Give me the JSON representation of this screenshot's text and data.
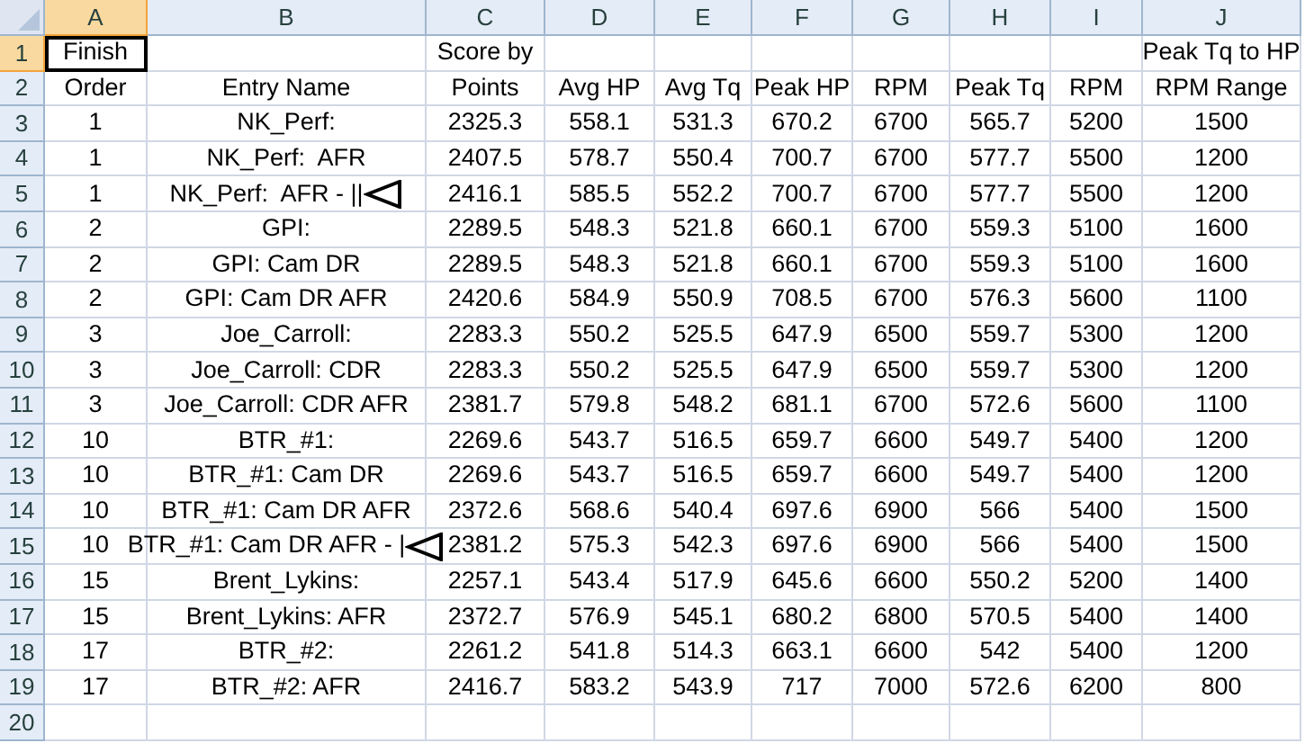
{
  "columns": [
    {
      "label": "A",
      "selected": true
    },
    {
      "label": "B",
      "selected": false
    },
    {
      "label": "C",
      "selected": false
    },
    {
      "label": "D",
      "selected": false
    },
    {
      "label": "E",
      "selected": false
    },
    {
      "label": "F",
      "selected": false
    },
    {
      "label": "G",
      "selected": false
    },
    {
      "label": "H",
      "selected": false
    },
    {
      "label": "I",
      "selected": false
    },
    {
      "label": "J",
      "selected": false
    }
  ],
  "rows": [
    {
      "number": "1",
      "selected": true,
      "arrow": false,
      "cells": [
        "Finish",
        null,
        "Score by",
        null,
        null,
        null,
        null,
        null,
        null,
        "Peak Tq to HP"
      ]
    },
    {
      "number": "2",
      "selected": false,
      "arrow": false,
      "cells": [
        "Order",
        "Entry Name",
        "Points",
        "Avg HP",
        "Avg Tq",
        "Peak HP",
        "RPM",
        "Peak Tq",
        "RPM",
        "RPM Range"
      ]
    },
    {
      "number": "3",
      "selected": false,
      "arrow": false,
      "cells": [
        "1",
        "NK_Perf:",
        "2325.3",
        "558.1",
        "531.3",
        "670.2",
        "6700",
        "565.7",
        "5200",
        "1500"
      ]
    },
    {
      "number": "4",
      "selected": false,
      "arrow": false,
      "cells": [
        "1",
        "NK_Perf:  AFR",
        "2407.5",
        "578.7",
        "550.4",
        "700.7",
        "6700",
        "577.7",
        "5500",
        "1200"
      ]
    },
    {
      "number": "5",
      "selected": false,
      "arrow": true,
      "cells": [
        "1",
        "NK_Perf:  AFR - ||",
        "2416.1",
        "585.5",
        "552.2",
        "700.7",
        "6700",
        "577.7",
        "5500",
        "1200"
      ]
    },
    {
      "number": "6",
      "selected": false,
      "arrow": false,
      "cells": [
        "2",
        "GPI:",
        "2289.5",
        "548.3",
        "521.8",
        "660.1",
        "6700",
        "559.3",
        "5100",
        "1600"
      ]
    },
    {
      "number": "7",
      "selected": false,
      "arrow": false,
      "cells": [
        "2",
        "GPI: Cam DR",
        "2289.5",
        "548.3",
        "521.8",
        "660.1",
        "6700",
        "559.3",
        "5100",
        "1600"
      ]
    },
    {
      "number": "8",
      "selected": false,
      "arrow": false,
      "cells": [
        "2",
        "GPI: Cam DR AFR",
        "2420.6",
        "584.9",
        "550.9",
        "708.5",
        "6700",
        "576.3",
        "5600",
        "1100"
      ]
    },
    {
      "number": "9",
      "selected": false,
      "arrow": false,
      "cells": [
        "3",
        "Joe_Carroll:",
        "2283.3",
        "550.2",
        "525.5",
        "647.9",
        "6500",
        "559.7",
        "5300",
        "1200"
      ]
    },
    {
      "number": "10",
      "selected": false,
      "arrow": false,
      "cells": [
        "3",
        "Joe_Carroll: CDR",
        "2283.3",
        "550.2",
        "525.5",
        "647.9",
        "6500",
        "559.7",
        "5300",
        "1200"
      ]
    },
    {
      "number": "11",
      "selected": false,
      "arrow": false,
      "cells": [
        "3",
        "Joe_Carroll: CDR AFR",
        "2381.7",
        "579.8",
        "548.2",
        "681.1",
        "6700",
        "572.6",
        "5600",
        "1100"
      ]
    },
    {
      "number": "12",
      "selected": false,
      "arrow": false,
      "cells": [
        "10",
        "BTR_#1:",
        "2269.6",
        "543.7",
        "516.5",
        "659.7",
        "6600",
        "549.7",
        "5400",
        "1200"
      ]
    },
    {
      "number": "13",
      "selected": false,
      "arrow": false,
      "cells": [
        "10",
        "BTR_#1: Cam DR",
        "2269.6",
        "543.7",
        "516.5",
        "659.7",
        "6600",
        "549.7",
        "5400",
        "1200"
      ]
    },
    {
      "number": "14",
      "selected": false,
      "arrow": false,
      "cells": [
        "10",
        "BTR_#1: Cam DR AFR",
        "2372.6",
        "568.6",
        "540.4",
        "697.6",
        "6900",
        "566",
        "5400",
        "1500"
      ]
    },
    {
      "number": "15",
      "selected": false,
      "arrow": true,
      "cells": [
        "10",
        "BTR_#1: Cam DR AFR - |",
        "2381.2",
        "575.3",
        "542.3",
        "697.6",
        "6900",
        "566",
        "5400",
        "1500"
      ]
    },
    {
      "number": "16",
      "selected": false,
      "arrow": false,
      "cells": [
        "15",
        "Brent_Lykins:",
        "2257.1",
        "543.4",
        "517.9",
        "645.6",
        "6600",
        "550.2",
        "5200",
        "1400"
      ]
    },
    {
      "number": "17",
      "selected": false,
      "arrow": false,
      "cells": [
        "15",
        "Brent_Lykins: AFR",
        "2372.7",
        "576.9",
        "545.1",
        "680.2",
        "6800",
        "570.5",
        "5400",
        "1400"
      ]
    },
    {
      "number": "18",
      "selected": false,
      "arrow": false,
      "cells": [
        "17",
        "BTR_#2:",
        "2261.2",
        "541.8",
        "514.3",
        "663.1",
        "6600",
        "542",
        "5400",
        "1200"
      ]
    },
    {
      "number": "19",
      "selected": false,
      "arrow": false,
      "cells": [
        "17",
        "BTR_#2: AFR",
        "2416.7",
        "583.2",
        "543.9",
        "717",
        "7000",
        "572.6",
        "6200",
        "800"
      ]
    },
    {
      "number": "20",
      "selected": false,
      "arrow": false,
      "cells": [
        null,
        null,
        null,
        null,
        null,
        null,
        null,
        null,
        null,
        null
      ]
    }
  ]
}
